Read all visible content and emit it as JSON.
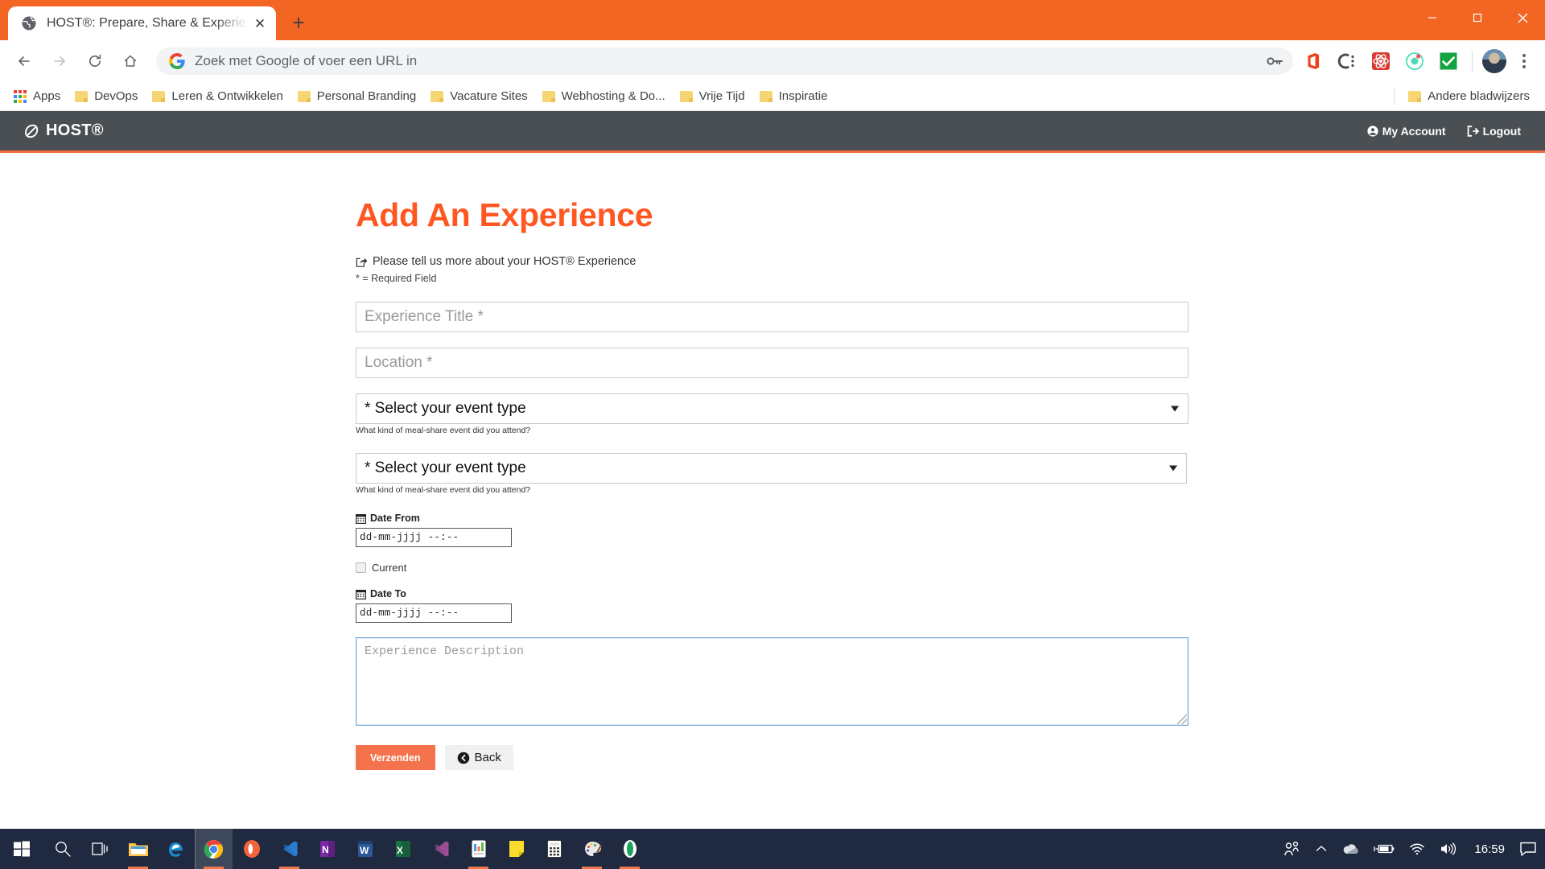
{
  "browser": {
    "tab": {
      "title": "HOST®: Prepare, Share & Experie",
      "favicon_name": "globe-favicon",
      "close_label": "✕"
    },
    "new_tab_label": "+",
    "window_controls": {
      "minimize": "─",
      "maximize": "❐",
      "close": "✕"
    },
    "nav": {
      "back": "←",
      "forward": "→",
      "reload": "↻",
      "home": "⌂"
    },
    "omnibox": {
      "placeholder": "Zoek met Google of voer een URL in",
      "value": ""
    },
    "extensions": [
      "password-key-icon",
      "office-icon",
      "cisco-icon",
      "react-devtools-icon",
      "ionic-icon",
      "checkmark-icon"
    ],
    "bookmarks": [
      {
        "label": "Apps",
        "icon": "apps-grid-icon"
      },
      {
        "label": "DevOps",
        "icon": "folder-icon"
      },
      {
        "label": "Leren & Ontwikkelen",
        "icon": "folder-icon"
      },
      {
        "label": "Personal Branding",
        "icon": "folder-icon"
      },
      {
        "label": "Vacature Sites",
        "icon": "folder-icon"
      },
      {
        "label": "Webhosting & Do...",
        "icon": "folder-icon"
      },
      {
        "label": "Vrije Tijd",
        "icon": "folder-icon"
      },
      {
        "label": "Inspiratie",
        "icon": "folder-icon"
      }
    ],
    "other_bookmarks": {
      "label": "Andere bladwijzers",
      "icon": "folder-icon"
    }
  },
  "site": {
    "brand": "HOST®",
    "header_links": [
      {
        "label": "My Account",
        "icon": "user-circle-icon"
      },
      {
        "label": "Logout",
        "icon": "sign-out-icon"
      }
    ],
    "accent_color": "#f26c3e",
    "header_bg": "#4a4f54"
  },
  "main": {
    "heading": "Add An Experience",
    "heading_color": "#ff5722",
    "lede": "Please tell us more about your HOST® Experience",
    "lede_icon": "share-square-icon",
    "required_note": "* = Required Field",
    "fields": {
      "title_placeholder": "Experience Title *",
      "location_placeholder": "Location *",
      "event_type_1": {
        "value": "* Select your event type",
        "help": "What kind of meal-share event did you attend?"
      },
      "event_type_2": {
        "value": "* Select your event type",
        "help": "What kind of meal-share event did you attend?"
      },
      "date_from": {
        "label": "Date From",
        "icon": "calendar-icon",
        "value": "dd-mm-jjjj --:--"
      },
      "current": {
        "label": "Current",
        "checked": false
      },
      "date_to": {
        "label": "Date To",
        "icon": "calendar-icon",
        "value": "dd-mm-jjjj --:--"
      },
      "description_placeholder": "Experience Description"
    },
    "buttons": {
      "submit": "Verzenden",
      "back": "Back",
      "back_icon": "arrow-circle-left-icon"
    }
  },
  "taskbar": {
    "items": [
      {
        "name": "start-button",
        "icon": "windows-icon"
      },
      {
        "name": "search-button",
        "icon": "search-icon"
      },
      {
        "name": "task-view-button",
        "icon": "task-view-icon"
      },
      {
        "name": "file-explorer",
        "icon": "file-explorer-icon",
        "running": true
      },
      {
        "name": "edge-browser",
        "icon": "edge-icon",
        "running": false
      },
      {
        "name": "chrome-browser",
        "icon": "chrome-icon",
        "running": true,
        "active": true
      },
      {
        "name": "opera-browser",
        "icon": "opera-icon",
        "running": false
      },
      {
        "name": "vscode",
        "icon": "vscode-icon",
        "running": true
      },
      {
        "name": "onenote",
        "icon": "onenote-icon",
        "running": false
      },
      {
        "name": "word",
        "icon": "word-icon",
        "running": false
      },
      {
        "name": "excel",
        "icon": "excel-icon",
        "running": false
      },
      {
        "name": "visual-studio",
        "icon": "visual-studio-icon",
        "running": false
      },
      {
        "name": "store-app",
        "icon": "store-icon",
        "running": true
      },
      {
        "name": "sticky-notes",
        "icon": "sticky-notes-icon",
        "running": false
      },
      {
        "name": "calculator",
        "icon": "calculator-icon",
        "running": false
      },
      {
        "name": "paint",
        "icon": "paint-icon",
        "running": true
      },
      {
        "name": "oval-app",
        "icon": "oval-app-icon",
        "running": true
      }
    ],
    "tray": {
      "people": "people-icon",
      "chevron": "chevron-up-icon",
      "onedrive": "onedrive-icon",
      "battery": "battery-charging-icon",
      "wifi": "wifi-icon",
      "volume": "volume-icon",
      "clock": "16:59",
      "action_center": "action-center-icon"
    }
  }
}
